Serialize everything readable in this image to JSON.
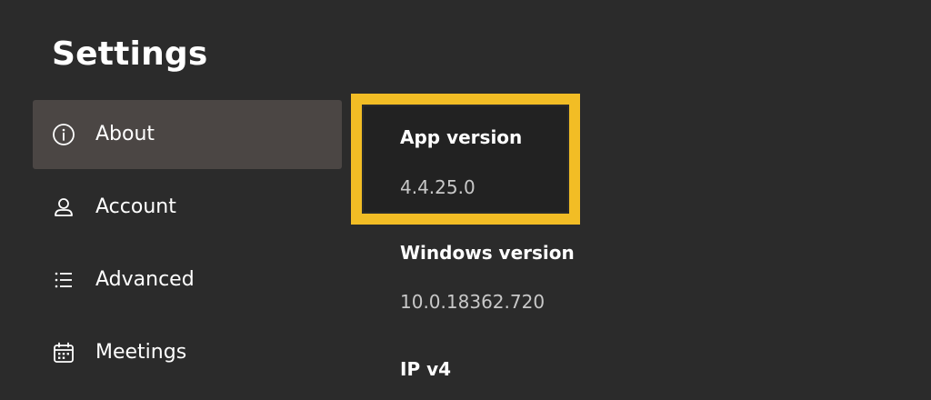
{
  "page": {
    "title": "Settings"
  },
  "sidebar": {
    "items": [
      {
        "label": "About",
        "icon": "info-icon",
        "selected": true
      },
      {
        "label": "Account",
        "icon": "person-icon",
        "selected": false
      },
      {
        "label": "Advanced",
        "icon": "list-icon",
        "selected": false
      },
      {
        "label": "Meetings",
        "icon": "calendar-icon",
        "selected": false
      }
    ]
  },
  "about": {
    "app_version_label": "App version",
    "app_version_value": "4.4.25.0",
    "windows_version_label": "Windows version",
    "windows_version_value": "10.0.18362.720",
    "ip_label": "IP v4"
  },
  "colors": {
    "background": "#2b2b2b",
    "selected_item": "#4b4644",
    "focus_highlight": "#f2bd25",
    "secondary_text": "#c8c8c8"
  }
}
